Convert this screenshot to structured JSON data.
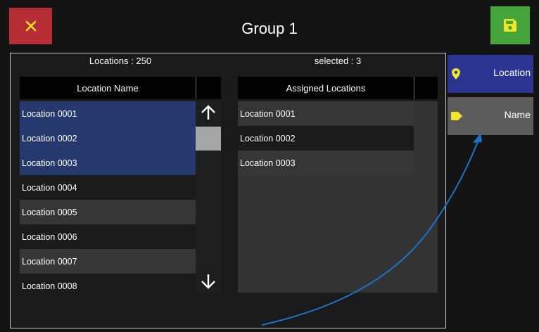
{
  "header": {
    "title": "Group 1",
    "close_icon": "close-icon",
    "save_icon": "save-icon"
  },
  "left_list": {
    "count_label": "Locations : 250",
    "column_header": "Location Name",
    "items": [
      {
        "label": "Location 0001",
        "selected": true
      },
      {
        "label": "Location 0002",
        "selected": true
      },
      {
        "label": "Location 0003",
        "selected": true
      },
      {
        "label": "Location 0004",
        "selected": false
      },
      {
        "label": "Location 0005",
        "selected": false
      },
      {
        "label": "Location 0006",
        "selected": false
      },
      {
        "label": "Location 0007",
        "selected": false
      },
      {
        "label": "Location 0008",
        "selected": false
      }
    ]
  },
  "scrollbar": {
    "up_icon": "arrow-up-icon",
    "down_icon": "arrow-down-icon"
  },
  "right_list": {
    "count_label": "selected : 3",
    "column_header": "Assigned Locations",
    "items": [
      {
        "label": "Location 0001"
      },
      {
        "label": "Location 0002"
      },
      {
        "label": "Location 0003"
      }
    ]
  },
  "sidebar": {
    "location_button": {
      "label": "Location",
      "icon": "map-pin-icon"
    },
    "name_button": {
      "label": "Name",
      "icon": "tag-icon"
    }
  },
  "colors": {
    "close": "#b62d35",
    "save": "#45a43a",
    "selected_row": "#26386e",
    "location_button": "#2b3591",
    "name_button": "#5c5c5c",
    "annotation_arrow": "#1a73c8",
    "icon_yellow": "#f2e62a"
  }
}
